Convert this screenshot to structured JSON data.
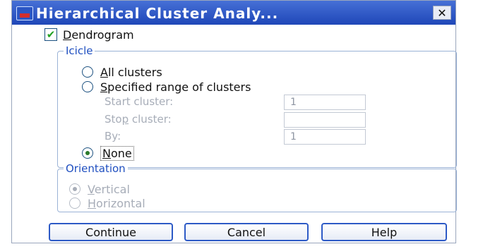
{
  "window": {
    "title": "Hierarchical Cluster Analy...",
    "close_glyph": "✕"
  },
  "dendrogram": {
    "label_ul": "D",
    "label_rest": "endrogram",
    "checked": true
  },
  "icicle": {
    "legend": "Icicle",
    "all_clusters": {
      "label_ul": "A",
      "label_rest": "ll clusters",
      "selected": false
    },
    "specified_range": {
      "label_ul": "S",
      "label_rest": "pecified range of clusters",
      "selected": false
    },
    "start_cluster": {
      "label": "Start cluster:",
      "value": "1"
    },
    "stop_cluster": {
      "label_pre": "Sto",
      "label_ul": "p",
      "label_rest": " cluster:",
      "value": ""
    },
    "by": {
      "label": "By:",
      "value": "1"
    },
    "none": {
      "label_ul": "N",
      "label_rest": "one",
      "selected": true
    }
  },
  "orientation": {
    "legend": "Orientation",
    "vertical": {
      "label_ul": "V",
      "label_rest": "ertical",
      "selected": true
    },
    "horizontal": {
      "label_ul": "H",
      "label_rest": "orizontal",
      "selected": false
    }
  },
  "buttons": {
    "continue": "Continue",
    "cancel": "Cancel",
    "help": "Help"
  },
  "colors": {
    "title_bar": "#2b56c4",
    "legend_text": "#1f4fc0",
    "disabled_text": "#a7adb8"
  }
}
